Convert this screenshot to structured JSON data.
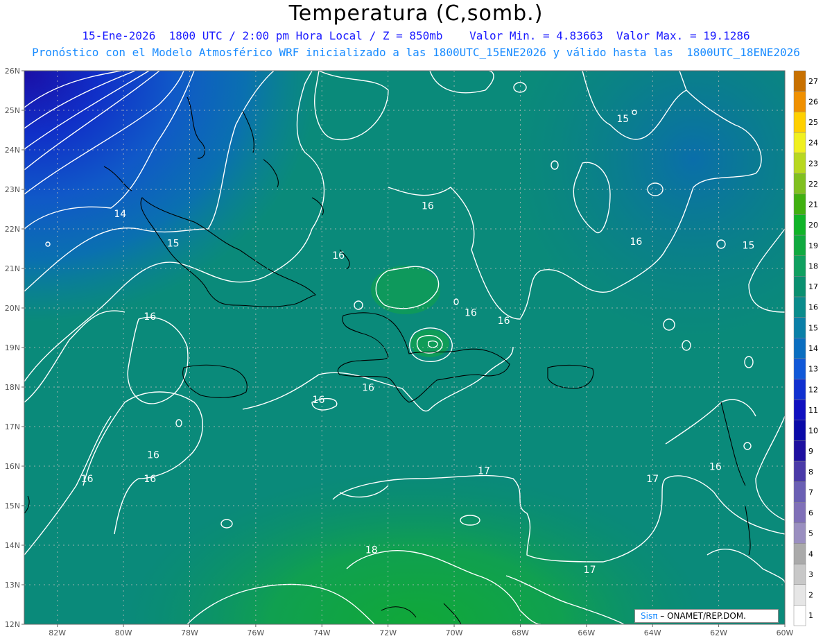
{
  "header": {
    "title": "Temperatura (C,somb.)",
    "subtitle1": "15-Ene-2026  1800 UTC / 2:00 pm Hora Local / Z = 850mb    Valor Min. = 4.83663  Valor Max. = 19.1286",
    "subtitle2": "Pronóstico con el Modelo Atmosférico WRF inicializado a las 1800UTC_15ENE2026 y válido hasta las  1800UTC_18ENE2026"
  },
  "map": {
    "lat_labels": [
      "26N",
      "25N",
      "24N",
      "23N",
      "22N",
      "21N",
      "20N",
      "19N",
      "18N",
      "17N",
      "16N",
      "15N",
      "14N",
      "13N",
      "12N"
    ],
    "lon_labels": [
      "82W",
      "80W",
      "78W",
      "76W",
      "74W",
      "72W",
      "70W",
      "68W",
      "66W",
      "64W",
      "62W",
      "60W"
    ],
    "contour_labels": [
      {
        "text": "14",
        "lon": -80.1,
        "lat": 22.3
      },
      {
        "text": "15",
        "lon": -78.5,
        "lat": 21.55
      },
      {
        "text": "15",
        "lon": -64.9,
        "lat": 24.7
      },
      {
        "text": "15",
        "lon": -61.1,
        "lat": 21.5
      },
      {
        "text": "16",
        "lon": -70.8,
        "lat": 22.5
      },
      {
        "text": "16",
        "lon": -73.5,
        "lat": 21.25
      },
      {
        "text": "16",
        "lon": -64.5,
        "lat": 21.6
      },
      {
        "text": "16",
        "lon": -79.2,
        "lat": 19.7
      },
      {
        "text": "16",
        "lon": -69.5,
        "lat": 19.8
      },
      {
        "text": "16",
        "lon": -68.5,
        "lat": 19.6
      },
      {
        "text": "16",
        "lon": -72.6,
        "lat": 17.9
      },
      {
        "text": "16",
        "lon": -74.1,
        "lat": 17.6
      },
      {
        "text": "16",
        "lon": -79.1,
        "lat": 16.2
      },
      {
        "text": "16",
        "lon": -81.1,
        "lat": 15.6
      },
      {
        "text": "16",
        "lon": -79.2,
        "lat": 15.6
      },
      {
        "text": "16",
        "lon": -62.1,
        "lat": 15.9
      },
      {
        "text": "17",
        "lon": -69.1,
        "lat": 15.8
      },
      {
        "text": "17",
        "lon": -64.0,
        "lat": 15.6
      },
      {
        "text": "17",
        "lon": -65.9,
        "lat": 13.3
      },
      {
        "text": "18",
        "lon": -72.5,
        "lat": 13.8
      }
    ]
  },
  "colorbar": {
    "labels": [
      "1",
      "2",
      "3",
      "4",
      "5",
      "6",
      "7",
      "8",
      "9",
      "10",
      "11",
      "12",
      "13",
      "14",
      "15",
      "16",
      "17",
      "18",
      "19",
      "20",
      "21",
      "22",
      "23",
      "24",
      "25",
      "26",
      "27"
    ],
    "colors": [
      "#ffffff",
      "#e6e6e6",
      "#c8c8c8",
      "#aaaaaa",
      "#9a8fc0",
      "#8070b8",
      "#6a5fb4",
      "#4a3aa8",
      "#1e10a0",
      "#0a0aa8",
      "#1010c0",
      "#1030d0",
      "#1058d8",
      "#0a6ec0",
      "#0a80a8",
      "#0a8c8c",
      "#0a9070",
      "#10a060",
      "#10aa40",
      "#10b428",
      "#40b010",
      "#80c020",
      "#b8d820",
      "#f0f020",
      "#ffd000",
      "#f09000",
      "#c87000"
    ]
  },
  "credit": {
    "sis": "Sisπ",
    "org": "– ONAMET/REP.DOM."
  }
}
